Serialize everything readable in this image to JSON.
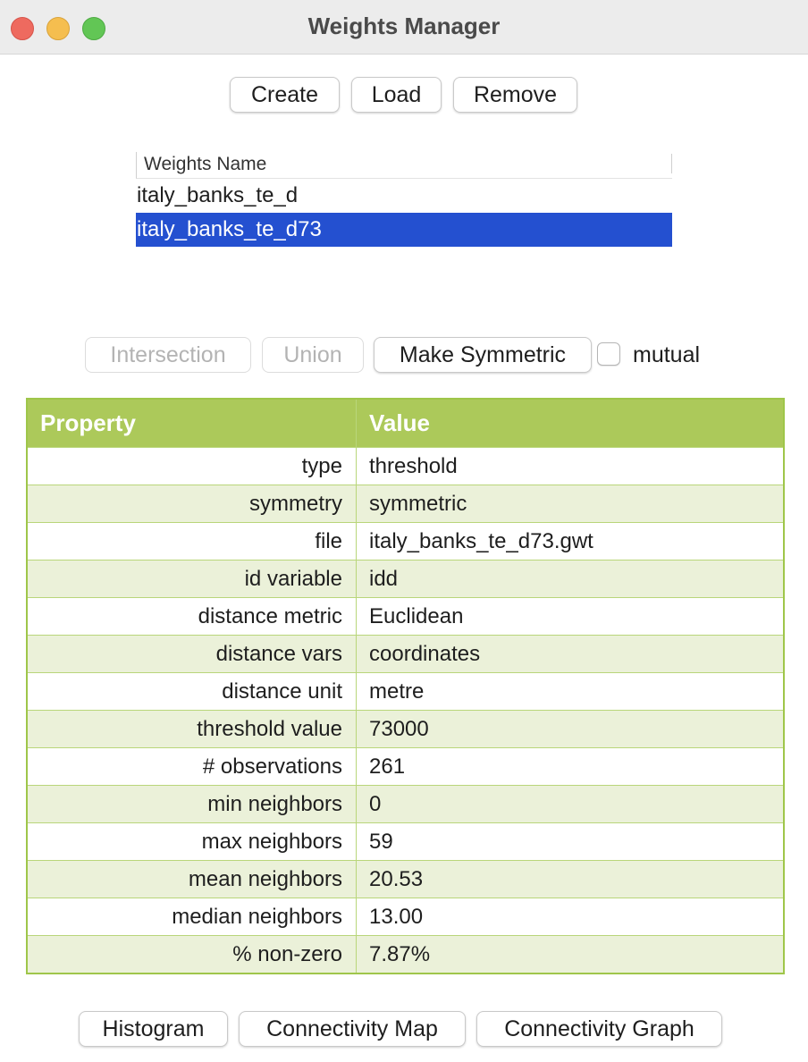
{
  "window": {
    "title": "Weights Manager"
  },
  "top_buttons": {
    "create": "Create",
    "load": "Load",
    "remove": "Remove"
  },
  "weights_list": {
    "header": "Weights Name",
    "items": [
      {
        "name": "italy_banks_te_d",
        "selected": false
      },
      {
        "name": "italy_banks_te_d73",
        "selected": true
      }
    ]
  },
  "ops": {
    "intersection": "Intersection",
    "union": "Union",
    "make_symmetric": "Make Symmetric",
    "mutual_label": "mutual",
    "mutual_checked": false
  },
  "properties": {
    "header_property": "Property",
    "header_value": "Value",
    "rows": [
      {
        "key": "type",
        "value": "threshold"
      },
      {
        "key": "symmetry",
        "value": "symmetric"
      },
      {
        "key": "file",
        "value": "italy_banks_te_d73.gwt"
      },
      {
        "key": "id variable",
        "value": "idd"
      },
      {
        "key": "distance metric",
        "value": "Euclidean"
      },
      {
        "key": "distance vars",
        "value": "coordinates"
      },
      {
        "key": "distance unit",
        "value": "metre"
      },
      {
        "key": "threshold value",
        "value": "73000"
      },
      {
        "key": "# observations",
        "value": "261"
      },
      {
        "key": "min neighbors",
        "value": "0"
      },
      {
        "key": "max neighbors",
        "value": "59"
      },
      {
        "key": "mean neighbors",
        "value": "20.53"
      },
      {
        "key": "median neighbors",
        "value": "13.00"
      },
      {
        "key": "% non-zero",
        "value": "7.87%"
      }
    ]
  },
  "bottom_buttons": {
    "histogram": "Histogram",
    "connectivity_map": "Connectivity Map",
    "connectivity_graph": "Connectivity Graph"
  },
  "colors": {
    "header_green": "#acc95a",
    "row_alt": "#ebf1d9",
    "selection_blue": "#2450d0"
  }
}
